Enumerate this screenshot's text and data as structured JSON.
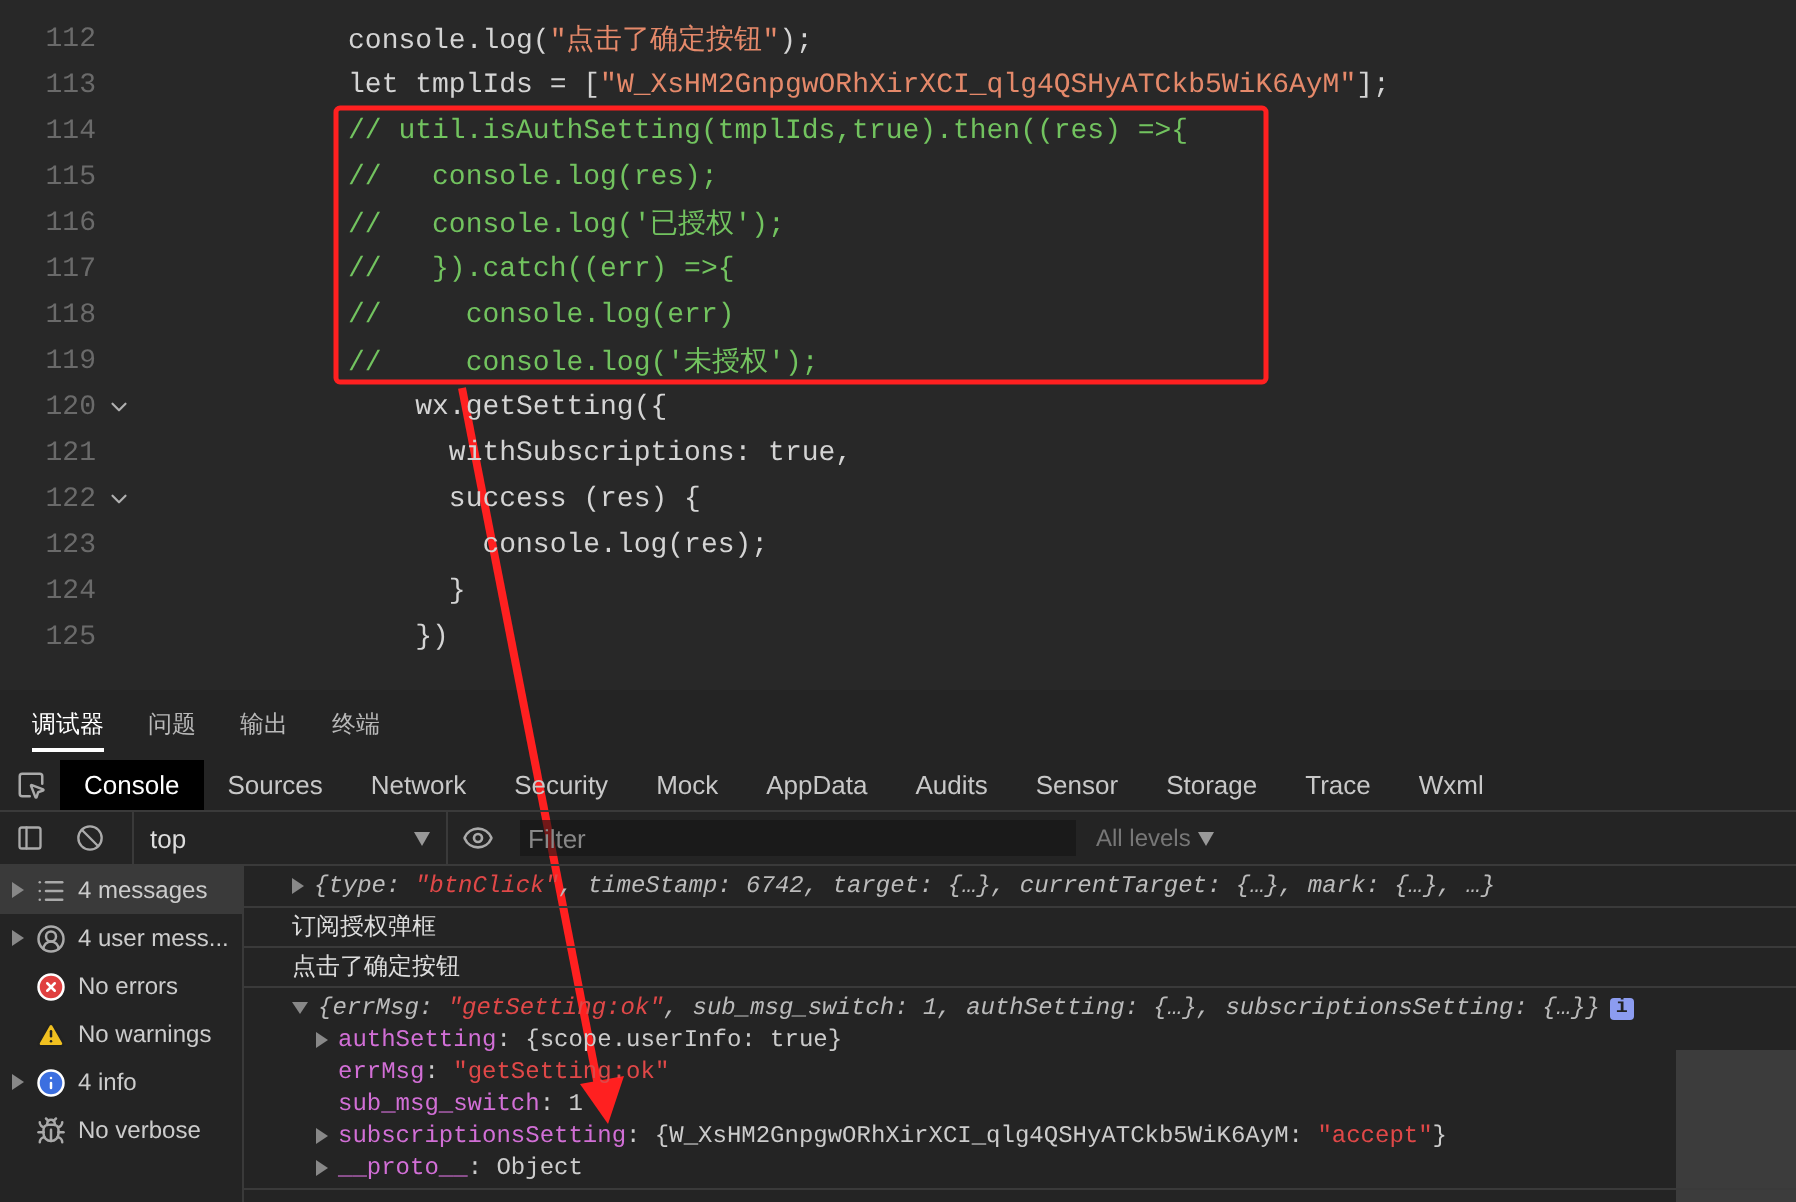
{
  "editor": {
    "lines": [
      {
        "number": "112",
        "foldable": false,
        "kind": "code",
        "text": "          console.log(\"点击了确定按钮\");"
      },
      {
        "number": "113",
        "foldable": false,
        "kind": "code",
        "text": "          let tmplIds = [\"W_XsHM2GnpgwORhXirXCI_qlg4QSHyATCkb5WiK6AyM\"];"
      },
      {
        "number": "114",
        "foldable": false,
        "kind": "comment",
        "text": "          // util.isAuthSetting(tmplIds,true).then((res) =>{"
      },
      {
        "number": "115",
        "foldable": false,
        "kind": "comment",
        "text": "          //   console.log(res);"
      },
      {
        "number": "116",
        "foldable": false,
        "kind": "comment",
        "text": "          //   console.log('已授权');"
      },
      {
        "number": "117",
        "foldable": false,
        "kind": "comment",
        "text": "          //   }).catch((err) =>{"
      },
      {
        "number": "118",
        "foldable": false,
        "kind": "comment",
        "text": "          //     console.log(err)"
      },
      {
        "number": "119",
        "foldable": false,
        "kind": "comment",
        "text": "          //     console.log('未授权');"
      },
      {
        "number": "120",
        "foldable": true,
        "kind": "code",
        "text": "              wx.getSetting({"
      },
      {
        "number": "121",
        "foldable": false,
        "kind": "code",
        "text": "                withSubscriptions: true,"
      },
      {
        "number": "122",
        "foldable": true,
        "kind": "code",
        "text": "                success (res) {"
      },
      {
        "number": "123",
        "foldable": false,
        "kind": "code",
        "text": "                  console.log(res);"
      },
      {
        "number": "124",
        "foldable": false,
        "kind": "code",
        "text": "                }"
      },
      {
        "number": "125",
        "foldable": false,
        "kind": "code",
        "text": "              })"
      }
    ]
  },
  "panel_tabs": [
    {
      "label": "调试器",
      "selected": true
    },
    {
      "label": "问题",
      "selected": false
    },
    {
      "label": "输出",
      "selected": false
    },
    {
      "label": "终端",
      "selected": false
    }
  ],
  "tool_tabs": [
    {
      "label": "Console",
      "selected": true
    },
    {
      "label": "Sources",
      "selected": false
    },
    {
      "label": "Network",
      "selected": false
    },
    {
      "label": "Security",
      "selected": false
    },
    {
      "label": "Mock",
      "selected": false
    },
    {
      "label": "AppData",
      "selected": false
    },
    {
      "label": "Audits",
      "selected": false
    },
    {
      "label": "Sensor",
      "selected": false
    },
    {
      "label": "Storage",
      "selected": false
    },
    {
      "label": "Trace",
      "selected": false
    },
    {
      "label": "Wxml",
      "selected": false
    }
  ],
  "toolbar": {
    "context": "top",
    "filter": {
      "placeholder": "Filter"
    },
    "levels": "All levels"
  },
  "sidebar": [
    {
      "label": "4 messages",
      "kind": "messages",
      "expandable": true,
      "selected": true
    },
    {
      "label": "4 user mess...",
      "kind": "user",
      "expandable": true,
      "selected": false
    },
    {
      "label": "No errors",
      "kind": "errors",
      "expandable": false,
      "selected": false
    },
    {
      "label": "No warnings",
      "kind": "warnings",
      "expandable": false,
      "selected": false
    },
    {
      "label": "4 info",
      "kind": "info",
      "expandable": true,
      "selected": false
    },
    {
      "label": "No verbose",
      "kind": "verbose",
      "expandable": false,
      "selected": false
    }
  ],
  "console": [
    {
      "kind": "object",
      "expanded": false,
      "text": "{type: \"btnClick\", timeStamp: 6742, target: {…}, currentTarget: {…}, mark: {…}, …}"
    },
    {
      "kind": "text",
      "text": "订阅授权弹框"
    },
    {
      "kind": "text",
      "text": "点击了确定按钮"
    },
    {
      "kind": "object",
      "expanded": true,
      "badge": "i",
      "text": "{errMsg: \"getSetting:ok\", sub_msg_switch: 1, authSetting: {…}, subscriptionsSetting: {…}}",
      "children": [
        {
          "expandable": true,
          "key": "authSetting",
          "value": ": {scope.userInfo: true}"
        },
        {
          "expandable": false,
          "key": "errMsg",
          "value": ": \"getSetting:ok\""
        },
        {
          "expandable": false,
          "key": "sub_msg_switch",
          "value": ": 1"
        },
        {
          "expandable": true,
          "key": "subscriptionsSetting",
          "value": ": {W_XsHM2GnpgwORhXirXCI_qlg4QSHyATCkb5WiK6AyM: \"accept\"}"
        },
        {
          "expandable": true,
          "key": "__proto__",
          "value": ": Object"
        }
      ]
    }
  ]
}
